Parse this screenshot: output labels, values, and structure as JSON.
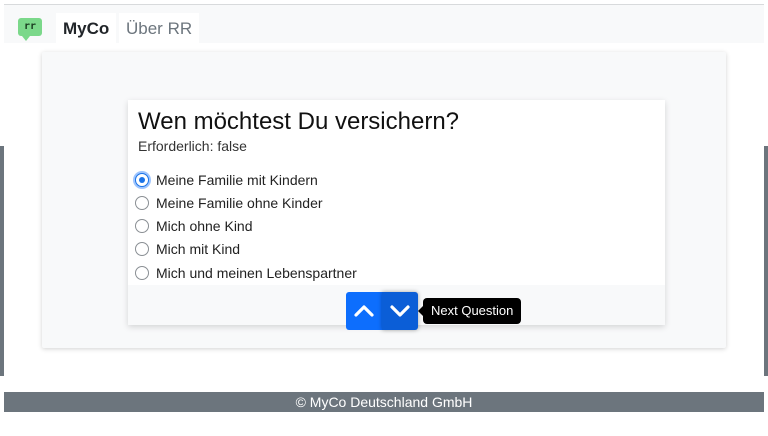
{
  "navbar": {
    "logo_text": "rr",
    "brand": "MyCo",
    "links": [
      "Über RR"
    ]
  },
  "question": {
    "title": "Wen möchtest Du versichern?",
    "required_text": "Erforderlich: false",
    "options": [
      {
        "label": "Meine Familie mit Kindern",
        "selected": true
      },
      {
        "label": "Meine Familie ohne Kinder",
        "selected": false
      },
      {
        "label": "Mich ohne Kind",
        "selected": false
      },
      {
        "label": "Mich mit Kind",
        "selected": false
      },
      {
        "label": "Mich und meinen Lebenspartner",
        "selected": false
      }
    ]
  },
  "navigation": {
    "previous_icon": "chevron-up-icon",
    "next_icon": "chevron-down-icon",
    "next_tooltip": "Next Question"
  },
  "footer": {
    "text": "© MyCo Deutschland GmbH"
  },
  "colors": {
    "primary": "#0d6efd",
    "footer": "#6c757d",
    "logo": "#7bd88a"
  }
}
